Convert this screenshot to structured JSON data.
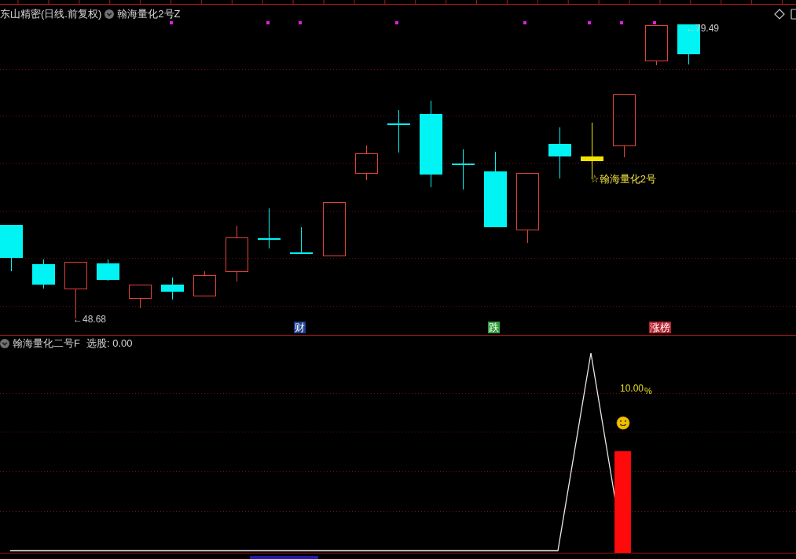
{
  "main_chart": {
    "title": "东山精密(日线.前复权)",
    "indicator": "翰海量化2号Z",
    "low_label": "←48.68",
    "high_label": "←79.49",
    "signal_label": "☆翰海量化2号",
    "event_tags": [
      {
        "label": "财",
        "color": "#1d3f8f"
      },
      {
        "label": "跌",
        "color": "#2f9a3a"
      },
      {
        "label": "涨榜",
        "color": "#b3202e"
      }
    ]
  },
  "sub_chart": {
    "indicator": "翰海量化二号F",
    "reading": "选股: 0.00",
    "value_label": "10.00",
    "unit_label": "%"
  }
}
